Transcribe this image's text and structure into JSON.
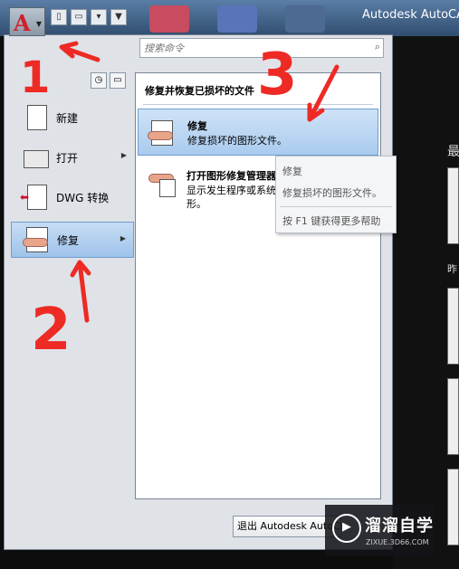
{
  "window": {
    "title": "Autodesk AutoCAD"
  },
  "app_button": {
    "logo": "A"
  },
  "search": {
    "placeholder": "搜索命令"
  },
  "left_menu": {
    "items": [
      {
        "label": "新建",
        "has_submenu": false
      },
      {
        "label": "打开",
        "has_submenu": true
      },
      {
        "label": "DWG 转换",
        "has_submenu": false
      },
      {
        "label": "修复",
        "has_submenu": true,
        "selected": true
      }
    ]
  },
  "submenu": {
    "title": "修复并恢复已损坏的文件",
    "items": [
      {
        "title": "修复",
        "description": "修复损坏的图形文件。",
        "selected": true
      },
      {
        "title": "打开图形修复管理器",
        "description": "显示发生程序或系统故障时可修复的图形。"
      }
    ]
  },
  "tooltip": {
    "title": "修复",
    "description": "修复损坏的图形文件。",
    "help": "按 F1 键获得更多帮助"
  },
  "exit_button": {
    "label": "退出 Autodesk AutoCAD"
  },
  "background": {
    "recent_label": "最",
    "yesterday_label": "昨"
  },
  "watermark": {
    "name": "溜溜自学",
    "url": "ZIXUE.3D66.COM"
  },
  "annotations": {
    "step1": "1",
    "step2": "2",
    "step3": "3"
  },
  "colors": {
    "highlight": "#a9cbee",
    "annotation": "#ee2a24",
    "logo_red": "#d0202a"
  }
}
